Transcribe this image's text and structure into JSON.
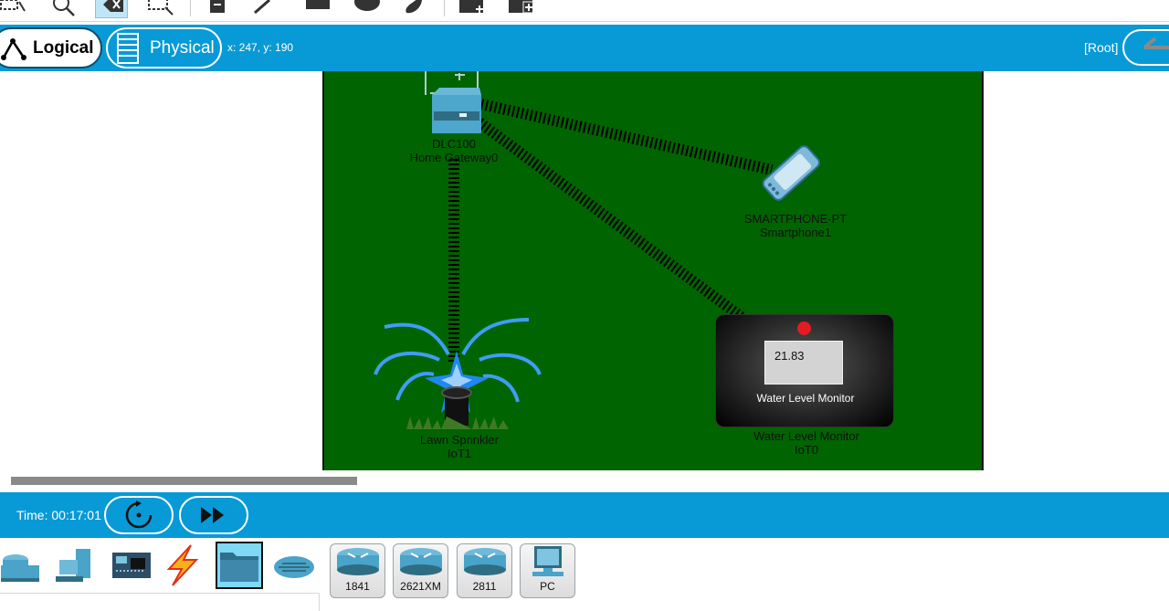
{
  "toolbar": {
    "tools": [
      "select-rect-icon",
      "zoom-icon",
      "delete-icon",
      "resize-select-icon",
      "note-icon",
      "draw-line-icon",
      "rectangle-icon",
      "ellipse-icon",
      "freeform-icon",
      "add-simple-pdu-icon",
      "add-complex-pdu-icon"
    ]
  },
  "viewbar": {
    "logical_label": "Logical",
    "physical_label": "Physical",
    "coords": "x: 247, y: 190",
    "root_label": "[Root]"
  },
  "devices": {
    "gateway": {
      "model": "DLC100",
      "name": "Home Gateway0"
    },
    "smartphone": {
      "model": "SMARTPHONE-PT",
      "name": "Smartphone1"
    },
    "sprinkler": {
      "model": "Lawn Sprinkler",
      "name": "IoT1"
    },
    "water_monitor": {
      "model": "Water Level Monitor",
      "name": "IoT0",
      "reading": "21.83",
      "panel_label": "Water Level Monitor"
    }
  },
  "timebar": {
    "time_text": "Time: 00:17:01"
  },
  "palette": {
    "categories": [
      "network-devices-icon",
      "end-devices-icon",
      "components-icon",
      "connections-icon",
      "miscellaneous-icon",
      "multiuser-icon"
    ],
    "models": [
      "1841",
      "2621XM",
      "2811",
      "PC"
    ]
  },
  "colors": {
    "accent_blue": "#079ad6",
    "canvas_green": "#006400",
    "status_red": "#e31b23"
  }
}
